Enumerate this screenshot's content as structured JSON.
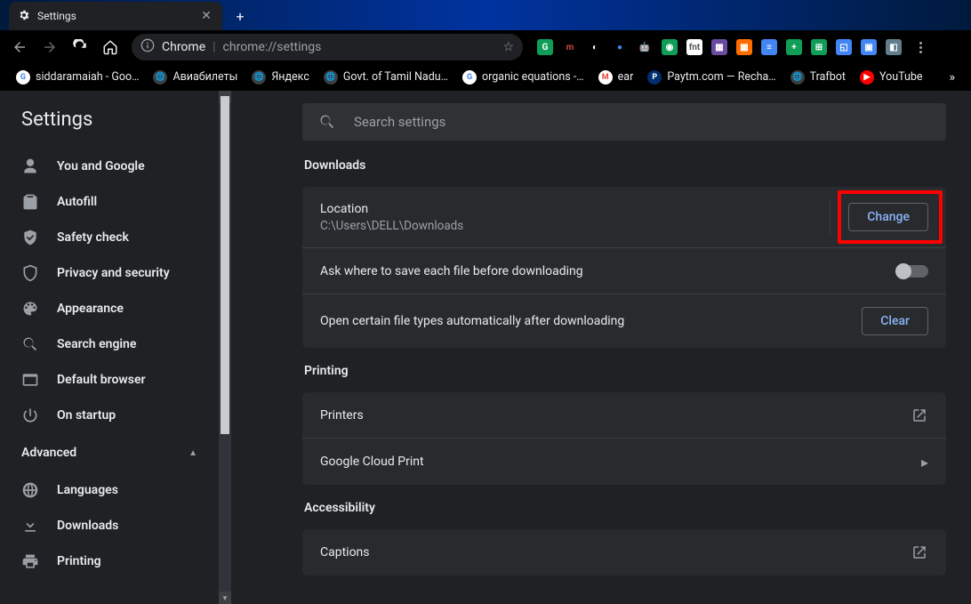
{
  "tab": {
    "title": "Settings"
  },
  "omnibox": {
    "label": "Chrome",
    "url": "chrome://settings"
  },
  "ext_colors": [
    {
      "bg": "#0f9d58",
      "fg": "#fff",
      "txt": "G"
    },
    {
      "bg": "#000",
      "fg": "#cf4647",
      "txt": "m"
    },
    {
      "bg": "#000",
      "fg": "#fff",
      "txt": "◐"
    },
    {
      "bg": "#000",
      "fg": "#4285f4",
      "txt": "●"
    },
    {
      "bg": "#000",
      "fg": "#ffb000",
      "txt": "🤖"
    },
    {
      "bg": "#0f9d58",
      "fg": "#fff",
      "txt": "◉"
    },
    {
      "bg": "#fff",
      "fg": "#555",
      "txt": "fnt"
    },
    {
      "bg": "#6b4ba1",
      "fg": "#fff",
      "txt": "▦"
    },
    {
      "bg": "#ff6d00",
      "fg": "#fff",
      "txt": "▦"
    },
    {
      "bg": "#4285f4",
      "fg": "#fff",
      "txt": "≡"
    },
    {
      "bg": "#0f9d58",
      "fg": "#fff",
      "txt": "+"
    },
    {
      "bg": "#0f9d58",
      "fg": "#fff",
      "txt": "⊞"
    },
    {
      "bg": "#4285f4",
      "fg": "#fff",
      "txt": "◱"
    },
    {
      "bg": "#4285f4",
      "fg": "#fff",
      "txt": "▣"
    },
    {
      "bg": "#607d8b",
      "fg": "#fff",
      "txt": "◧"
    }
  ],
  "bookmarks": [
    {
      "label": "siddaramaiah - Goo…",
      "icon_bg": "#fff",
      "icon_fg": "#4285f4",
      "icon_txt": "G"
    },
    {
      "label": "Авиабилеты",
      "icon_bg": "#3c4043",
      "icon_fg": "#fff",
      "icon_txt": "🌐"
    },
    {
      "label": "Яндекс",
      "icon_bg": "#3c4043",
      "icon_fg": "#fff",
      "icon_txt": "🌐"
    },
    {
      "label": "Govt. of Tamil Nadu…",
      "icon_bg": "#3c4043",
      "icon_fg": "#fff",
      "icon_txt": "🌐"
    },
    {
      "label": "organic equations -…",
      "icon_bg": "#fff",
      "icon_fg": "#4285f4",
      "icon_txt": "G"
    },
    {
      "label": "ear",
      "icon_bg": "#fff",
      "icon_fg": "#ea4335",
      "icon_txt": "M"
    },
    {
      "label": "Paytm.com — Recha…",
      "icon_bg": "#002e6e",
      "icon_fg": "#fff",
      "icon_txt": "P"
    },
    {
      "label": "Trafbot",
      "icon_bg": "#3c4043",
      "icon_fg": "#fff",
      "icon_txt": "🌐"
    },
    {
      "label": "YouTube",
      "icon_bg": "#ff0000",
      "icon_fg": "#fff",
      "icon_txt": "▶"
    }
  ],
  "app_title": "Settings",
  "search": {
    "placeholder": "Search settings"
  },
  "nav": {
    "items": [
      {
        "icon": "person",
        "label": "You and Google"
      },
      {
        "icon": "clipboard",
        "label": "Autofill"
      },
      {
        "icon": "shield-check",
        "label": "Safety check"
      },
      {
        "icon": "shield",
        "label": "Privacy and security"
      },
      {
        "icon": "palette",
        "label": "Appearance"
      },
      {
        "icon": "search",
        "label": "Search engine"
      },
      {
        "icon": "browser",
        "label": "Default browser"
      },
      {
        "icon": "power",
        "label": "On startup"
      }
    ],
    "advanced_label": "Advanced",
    "advanced_items": [
      {
        "icon": "globe",
        "label": "Languages"
      },
      {
        "icon": "download",
        "label": "Downloads"
      },
      {
        "icon": "print",
        "label": "Printing"
      }
    ]
  },
  "sections": {
    "downloads": {
      "title": "Downloads",
      "location_label": "Location",
      "location_value": "C:\\Users\\DELL\\Downloads",
      "change_btn": "Change",
      "ask_label": "Ask where to save each file before downloading",
      "open_label": "Open certain file types automatically after downloading",
      "clear_btn": "Clear"
    },
    "printing": {
      "title": "Printing",
      "printers": "Printers",
      "gcp": "Google Cloud Print"
    },
    "accessibility": {
      "title": "Accessibility",
      "captions": "Captions"
    }
  }
}
